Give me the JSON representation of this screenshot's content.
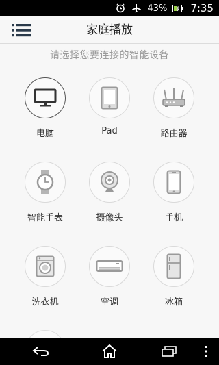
{
  "status_bar": {
    "battery_percent": "43%",
    "time": "7:35",
    "icons": [
      "alarm-icon",
      "airplane-mode-icon",
      "battery-icon"
    ]
  },
  "header": {
    "title": "家庭播放",
    "menu_icon": "menu-list-icon"
  },
  "prompt": "请选择您要连接的智能设备",
  "devices": [
    {
      "label": "电脑",
      "icon": "monitor-icon",
      "selected": true
    },
    {
      "label": "Pad",
      "icon": "tablet-icon",
      "selected": false
    },
    {
      "label": "路由器",
      "icon": "router-icon",
      "selected": false
    },
    {
      "label": "智能手表",
      "icon": "smartwatch-icon",
      "selected": false
    },
    {
      "label": "摄像头",
      "icon": "webcam-icon",
      "selected": false
    },
    {
      "label": "手机",
      "icon": "smartphone-icon",
      "selected": false
    },
    {
      "label": "洗衣机",
      "icon": "washing-machine-icon",
      "selected": false
    },
    {
      "label": "空调",
      "icon": "air-conditioner-icon",
      "selected": false
    },
    {
      "label": "冰箱",
      "icon": "refrigerator-icon",
      "selected": false
    }
  ],
  "nav_bar": {
    "icons": [
      "back-icon",
      "home-icon",
      "recent-apps-icon",
      "overflow-menu-icon"
    ]
  }
}
